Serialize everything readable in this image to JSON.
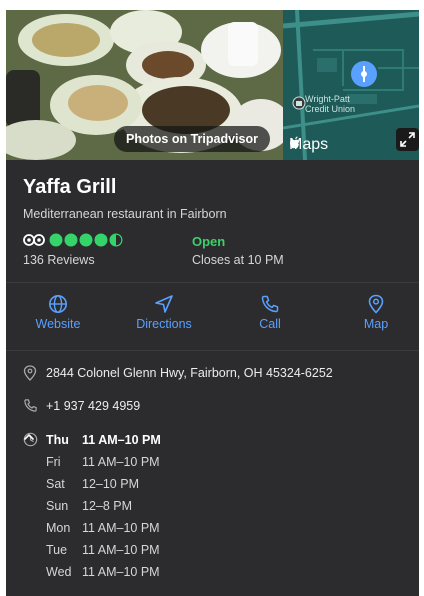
{
  "hero": {
    "photo_badge": "Photos on Tripadvisor",
    "map_label_line1": "Wright-Patt",
    "map_label_line2": "Credit Union",
    "map_brand": "Maps",
    "map_icon": "apple-logo-icon",
    "expand_icon": "expand-icon",
    "pin_color": "#5aa0ff"
  },
  "place": {
    "name": "Yaffa Grill",
    "category": "Mediterranean restaurant in Fairborn",
    "rating": 4.5,
    "rating_max": 5,
    "rating_color": "#34d46a",
    "reviews": "136 Reviews",
    "status": "Open",
    "closes": "Closes at 10 PM"
  },
  "actions": [
    {
      "label": "Website",
      "icon": "globe-icon"
    },
    {
      "label": "Directions",
      "icon": "directions-arrow-icon"
    },
    {
      "label": "Call",
      "icon": "phone-icon"
    },
    {
      "label": "Map",
      "icon": "map-pin-icon"
    }
  ],
  "details": {
    "address": "2844 Colonel Glenn Hwy, Fairborn, OH 45324-6252",
    "phone": "+1 937 429 4959",
    "hours_today": {
      "day": "Thu",
      "hours": "11 AM–10 PM"
    },
    "hours": [
      {
        "day": "Fri",
        "hours": "11 AM–10 PM"
      },
      {
        "day": "Sat",
        "hours": "12–10 PM"
      },
      {
        "day": "Sun",
        "hours": "12–8 PM"
      },
      {
        "day": "Mon",
        "hours": "11 AM–10 PM"
      },
      {
        "day": "Tue",
        "hours": "11 AM–10 PM"
      },
      {
        "day": "Wed",
        "hours": "11 AM–10 PM"
      }
    ]
  }
}
